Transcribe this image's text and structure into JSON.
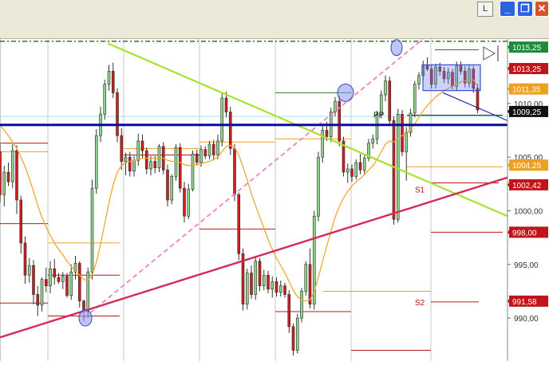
{
  "window": {
    "mode_label": "L",
    "minimize_glyph": "_",
    "maximize_glyph": "❐",
    "close_glyph": "✕"
  },
  "colors": {
    "bull": "#8fd28a",
    "bear": "#cc1f1f",
    "ma": "#f0a830",
    "support_green": "#a6e22e",
    "magenta_dash": "#ee82c8",
    "red_trend": "#d42a5a",
    "blue_line": "#0a0aa0",
    "pivot_red": "#c0141a",
    "pivot_orange": "#f0a020",
    "top_dashdot": "#2a7a2a"
  },
  "chart_data": {
    "type": "candlestick",
    "price_axis": {
      "range": [
        986,
        1016
      ],
      "tick_labels": [
        "990,00",
        "995,00",
        "1000,00",
        "1005,00",
        "1010,00"
      ]
    },
    "price_labels": [
      {
        "text": "1015,25",
        "value": 1015.25,
        "bg": "#1f8a3a"
      },
      {
        "text": "1013,25",
        "value": 1013.25,
        "bg": "#c0141a"
      },
      {
        "text": "1011,35",
        "value": 1011.35,
        "bg": "#f0a020"
      },
      {
        "text": "1009,25",
        "value": 1009.25,
        "bg": "#111111"
      },
      {
        "text": "1004,25",
        "value": 1004.25,
        "bg": "#f0a020"
      },
      {
        "text": "1002,42",
        "value": 1002.42,
        "bg": "#c0141a"
      },
      {
        "text": "998,00",
        "value": 998.0,
        "bg": "#c0141a"
      },
      {
        "text": "991,58",
        "value": 991.58,
        "bg": "#c0141a"
      }
    ],
    "annotations": [
      {
        "text": "S1",
        "x": 2.0,
        "price": 1002.0
      },
      {
        "text": "PP",
        "x": 1.8,
        "price": 1009.0
      },
      {
        "text": "S2",
        "x": 2.0,
        "price": 991.5
      }
    ],
    "candles": [
      [
        1005.5,
        1006.2,
        1000.8,
        1001.5
      ],
      [
        1001.5,
        1004.2,
        1000.4,
        1003.6
      ],
      [
        1003.6,
        1004.5,
        1002.3,
        1002.7
      ],
      [
        1002.7,
        1006.2,
        1002.1,
        1005.6
      ],
      [
        1005.6,
        1006.1,
        999.7,
        1001.0
      ],
      [
        1001.0,
        1001.4,
        996.0,
        997.0
      ],
      [
        997.0,
        997.6,
        993.2,
        994.0
      ],
      [
        994.0,
        995.6,
        993.3,
        994.9
      ],
      [
        994.9,
        995.4,
        991.3,
        992.2
      ],
      [
        992.2,
        993.0,
        990.2,
        991.2
      ],
      [
        991.2,
        993.8,
        990.6,
        993.6
      ],
      [
        993.6,
        994.7,
        992.4,
        993.0
      ],
      [
        993.0,
        995.3,
        992.3,
        994.6
      ],
      [
        994.6,
        995.5,
        993.1,
        993.8
      ],
      [
        993.8,
        994.2,
        993.2,
        993.4
      ],
      [
        993.4,
        994.3,
        992.7,
        993.9
      ],
      [
        993.9,
        994.2,
        991.9,
        992.1
      ],
      [
        992.1,
        995.0,
        991.7,
        994.3
      ],
      [
        994.3,
        995.8,
        993.6,
        995.1
      ],
      [
        995.1,
        995.3,
        991.0,
        991.6
      ],
      [
        991.6,
        991.7,
        989.7,
        990.6
      ],
      [
        990.6,
        994.7,
        990.0,
        994.3
      ],
      [
        994.3,
        1002.9,
        993.6,
        1002.1
      ],
      [
        1002.1,
        1007.6,
        1001.6,
        1007.0
      ],
      [
        1007.0,
        1009.7,
        1006.4,
        1009.0
      ],
      [
        1009.0,
        1012.2,
        1008.5,
        1011.8
      ],
      [
        1011.8,
        1013.6,
        1011.2,
        1013.0
      ],
      [
        1013.0,
        1013.8,
        1010.5,
        1011.0
      ],
      [
        1011.0,
        1011.4,
        1006.4,
        1007.0
      ],
      [
        1007.0,
        1007.7,
        1003.8,
        1004.6
      ],
      [
        1004.6,
        1005.4,
        1003.3,
        1005.0
      ],
      [
        1005.0,
        1005.5,
        1003.2,
        1003.7
      ],
      [
        1003.7,
        1005.1,
        1003.2,
        1004.7
      ],
      [
        1004.7,
        1007.2,
        1004.2,
        1006.5
      ],
      [
        1006.5,
        1007.1,
        1004.9,
        1005.6
      ],
      [
        1005.6,
        1005.9,
        1003.4,
        1003.9
      ],
      [
        1003.9,
        1005.1,
        1003.3,
        1004.6
      ],
      [
        1004.6,
        1005.1,
        1003.5,
        1004.0
      ],
      [
        1004.0,
        1006.2,
        1003.6,
        1006.0
      ],
      [
        1006.0,
        1006.4,
        1003.4,
        1003.8
      ],
      [
        1003.8,
        1004.3,
        1000.4,
        1001.0
      ],
      [
        1001.0,
        1003.4,
        1000.6,
        1003.2
      ],
      [
        1003.2,
        1006.2,
        1002.8,
        1005.9
      ],
      [
        1005.9,
        1006.3,
        1001.7,
        1002.1
      ],
      [
        1002.1,
        1002.7,
        998.9,
        999.5
      ],
      [
        999.5,
        1002.5,
        999.2,
        1002.0
      ],
      [
        1002.0,
        1005.6,
        1001.8,
        1005.3
      ],
      [
        1005.3,
        1005.7,
        1004.2,
        1004.5
      ],
      [
        1004.5,
        1006.1,
        1004.1,
        1005.7
      ],
      [
        1005.7,
        1006.0,
        1004.8,
        1005.1
      ],
      [
        1005.1,
        1006.5,
        1004.8,
        1006.2
      ],
      [
        1006.2,
        1006.6,
        1004.7,
        1005.2
      ],
      [
        1005.2,
        1007.1,
        1004.8,
        1006.5
      ],
      [
        1006.5,
        1011.0,
        1006.0,
        1010.5
      ],
      [
        1010.5,
        1011.1,
        1008.7,
        1009.2
      ],
      [
        1009.2,
        1009.7,
        1005.2,
        1005.8
      ],
      [
        1005.8,
        1006.2,
        1000.9,
        1001.5
      ],
      [
        1001.5,
        1001.7,
        995.4,
        996.0
      ],
      [
        996.0,
        996.5,
        990.7,
        991.3
      ],
      [
        991.3,
        994.6,
        990.8,
        994.2
      ],
      [
        994.2,
        994.9,
        991.8,
        992.2
      ],
      [
        992.2,
        995.8,
        991.7,
        995.3
      ],
      [
        995.3,
        995.6,
        992.5,
        993.0
      ],
      [
        993.0,
        994.5,
        992.6,
        994.0
      ],
      [
        994.0,
        994.4,
        992.3,
        992.7
      ],
      [
        992.7,
        993.9,
        991.9,
        993.4
      ],
      [
        993.4,
        993.8,
        992.0,
        992.4
      ],
      [
        992.4,
        993.5,
        992.0,
        993.0
      ],
      [
        993.0,
        993.3,
        991.9,
        992.2
      ],
      [
        992.2,
        992.6,
        988.6,
        989.2
      ],
      [
        989.2,
        989.5,
        986.5,
        987.0
      ],
      [
        987.0,
        990.4,
        986.7,
        990.0
      ],
      [
        990.0,
        992.8,
        989.6,
        992.5
      ],
      [
        992.5,
        995.3,
        992.1,
        995.0
      ],
      [
        995.0,
        996.5,
        990.9,
        991.3
      ],
      [
        991.3,
        1000.0,
        990.8,
        999.5
      ],
      [
        999.5,
        1005.5,
        999.0,
        1005.0
      ],
      [
        1005.0,
        1008.0,
        1004.5,
        1007.5
      ],
      [
        1007.5,
        1008.3,
        1006.5,
        1006.9
      ],
      [
        1006.9,
        1009.6,
        1006.4,
        1009.2
      ],
      [
        1009.2,
        1010.6,
        1008.8,
        1010.2
      ],
      [
        1010.2,
        1010.7,
        1006.0,
        1006.5
      ],
      [
        1006.5,
        1006.9,
        1003.2,
        1003.6
      ],
      [
        1003.6,
        1004.4,
        1002.6,
        1003.9
      ],
      [
        1003.9,
        1004.3,
        1002.7,
        1003.2
      ],
      [
        1003.2,
        1004.8,
        1002.9,
        1004.5
      ],
      [
        1004.5,
        1005.3,
        1003.4,
        1003.8
      ],
      [
        1003.8,
        1005.2,
        1003.3,
        1004.9
      ],
      [
        1004.9,
        1006.7,
        1004.6,
        1006.3
      ],
      [
        1006.3,
        1007.1,
        1005.8,
        1006.7
      ],
      [
        1006.7,
        1009.3,
        1006.2,
        1009.0
      ],
      [
        1009.0,
        1011.2,
        1008.6,
        1010.8
      ],
      [
        1010.8,
        1012.6,
        1010.2,
        1012.1
      ],
      [
        1012.1,
        1012.5,
        1008.0,
        1008.4
      ],
      [
        1008.4,
        1008.8,
        998.7,
        999.2
      ],
      [
        999.2,
        1009.5,
        998.9,
        1009.0
      ],
      [
        1009.0,
        1009.4,
        1005.1,
        1005.5
      ],
      [
        1005.5,
        1007.8,
        1002.8,
        1007.3
      ],
      [
        1007.3,
        1009.5,
        1006.9,
        1009.1
      ],
      [
        1009.1,
        1012.1,
        1008.7,
        1011.8
      ],
      [
        1011.8,
        1012.9,
        1011.3,
        1012.6
      ],
      [
        1012.6,
        1014.0,
        1012.1,
        1013.6
      ],
      [
        1013.6,
        1014.3,
        1013.0,
        1013.2
      ],
      [
        1013.2,
        1013.6,
        1011.4,
        1011.8
      ],
      [
        1011.8,
        1013.7,
        1011.4,
        1013.4
      ],
      [
        1013.4,
        1013.8,
        1012.6,
        1013.0
      ],
      [
        1013.0,
        1013.4,
        1011.9,
        1012.3
      ],
      [
        1012.3,
        1013.3,
        1011.8,
        1012.9
      ],
      [
        1012.9,
        1013.2,
        1011.3,
        1011.6
      ],
      [
        1011.6,
        1013.9,
        1011.2,
        1013.5
      ],
      [
        1013.5,
        1013.9,
        1012.7,
        1013.0
      ],
      [
        1013.0,
        1013.5,
        1011.5,
        1011.9
      ],
      [
        1011.9,
        1013.6,
        1011.5,
        1013.2
      ],
      [
        1013.2,
        1013.5,
        1011.0,
        1011.4
      ],
      [
        1011.4,
        1011.8,
        1009.1,
        1009.4
      ]
    ],
    "moving_average": [
      1008.0,
      1007.5,
      1007.0,
      1006.4,
      1005.8,
      1005.0,
      1004.1,
      1003.0,
      1001.8,
      1000.5,
      999.4,
      998.5,
      997.7,
      997.0,
      996.4,
      995.9,
      995.3,
      994.8,
      994.4,
      994.0,
      993.6,
      993.5,
      994.0,
      995.2,
      996.9,
      998.8,
      1000.7,
      1002.4,
      1003.6,
      1004.2,
      1004.5,
      1004.6,
      1004.7,
      1004.8,
      1004.9,
      1004.9,
      1004.9,
      1004.9,
      1004.9,
      1004.9,
      1004.7,
      1004.6,
      1004.6,
      1004.5,
      1004.3,
      1004.2,
      1004.3,
      1004.3,
      1004.4,
      1004.5,
      1004.6,
      1004.8,
      1005.0,
      1005.5,
      1006.0,
      1006.1,
      1005.9,
      1005.2,
      1004.1,
      1002.9,
      1001.6,
      1000.5,
      999.4,
      998.4,
      997.3,
      996.4,
      995.6,
      994.9,
      994.2,
      993.4,
      992.6,
      992.0,
      991.7,
      991.6,
      991.7,
      992.5,
      993.8,
      995.3,
      996.7,
      998.1,
      999.4,
      1000.4,
      1001.2,
      1001.8,
      1002.3,
      1002.7,
      1003.0,
      1003.4,
      1003.8,
      1004.2,
      1004.8,
      1005.5,
      1006.2,
      1006.5,
      1006.4,
      1006.8,
      1007.0,
      1007.2,
      1007.6,
      1008.1,
      1008.7,
      1009.3,
      1009.8,
      1010.2,
      1010.6,
      1010.9,
      1011.2,
      1011.4,
      1011.6,
      1011.8,
      1012.0,
      1012.1,
      1012.2,
      1012.2,
      1011.6
    ]
  }
}
